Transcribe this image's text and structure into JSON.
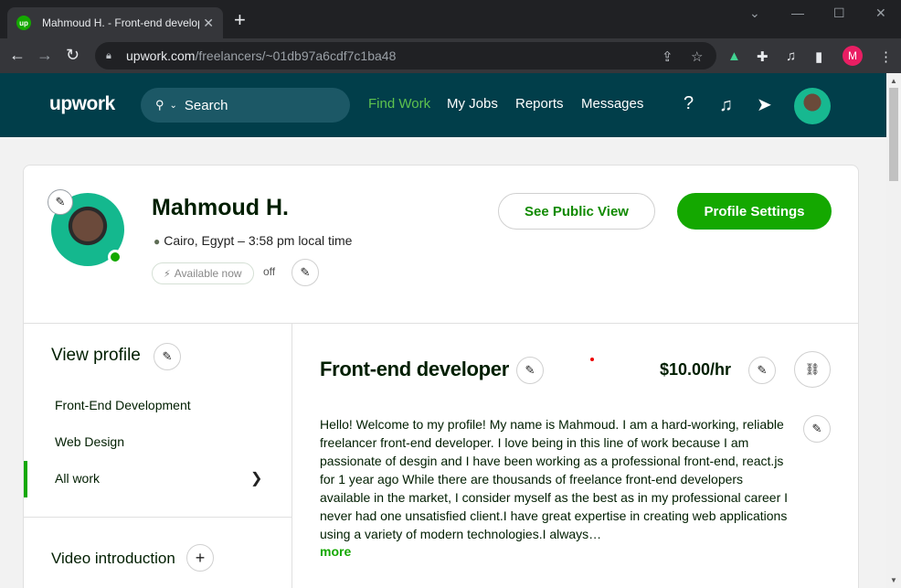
{
  "browser": {
    "tab_title": "Mahmoud H. - Front-end develop",
    "favicon_label": "up",
    "url_domain": "upwork.com",
    "url_path": "/freelancers/~01db97a6cdf7c1ba48",
    "profile_initial": "M"
  },
  "header": {
    "logo": "upwork",
    "search_label": "Search",
    "nav": [
      "Find Work",
      "My Jobs",
      "Reports",
      "Messages"
    ],
    "accent_color": "#5ec24e",
    "bg_color": "#013e4a"
  },
  "profile": {
    "name": "Mahmoud H.",
    "location": "Cairo, Egypt – 3:58 pm local time",
    "availability": "Available now",
    "availability_state": "off",
    "public_view_label": "See Public View",
    "settings_label": "Profile Settings"
  },
  "sidebar": {
    "title": "View profile",
    "items": [
      {
        "label": "Front-End Development"
      },
      {
        "label": "Web Design"
      },
      {
        "label": "All work"
      }
    ],
    "video_title": "Video introduction"
  },
  "main": {
    "job_title": "Front-end developer",
    "rate": "$10.00/hr",
    "bio": "Hello! Welcome to my profile! My name is Mahmoud. I am a hard-working, reliable freelancer front-end developer. I love being in this line of work because I am passionate of desgin and I have been working as a professional front-end, react.js for 1 year ago While there are thousands of freelance front-end developers available in the market, I consider myself as the best as in my professional career I never had one unsatisfied client.I have great expertise in creating web applications using a variety of modern technologies.I always…",
    "more_label": "more"
  }
}
